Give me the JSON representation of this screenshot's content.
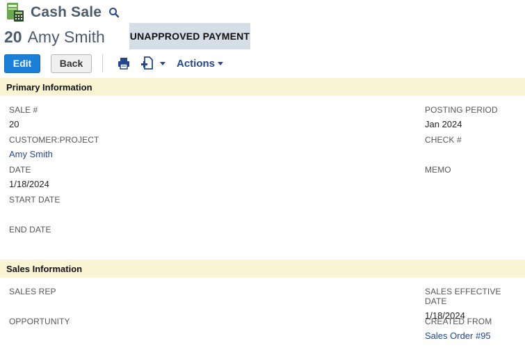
{
  "header": {
    "title": "Cash Sale",
    "record_number": "20",
    "record_name": "Amy Smith",
    "status": "UNAPPROVED PAYMENT"
  },
  "toolbar": {
    "edit_label": "Edit",
    "back_label": "Back",
    "actions_label": "Actions"
  },
  "icons": {
    "record": "cash-sale-record-icon",
    "search": "search-icon",
    "print": "print-icon",
    "new": "new-record-icon"
  },
  "primary": {
    "title": "Primary Information",
    "sale_num_label": "SALE #",
    "sale_num_value": "20",
    "customer_label": "CUSTOMER:PROJECT",
    "customer_value": "Amy Smith",
    "date_label": "DATE",
    "date_value": "1/18/2024",
    "start_date_label": "START DATE",
    "end_date_label": "END DATE",
    "posting_period_label": "POSTING PERIOD",
    "posting_period_value": "Jan 2024",
    "check_label": "CHECK #",
    "memo_label": "MEMO"
  },
  "sales": {
    "title": "Sales Information",
    "sales_rep_label": "SALES REP",
    "opportunity_label": "OPPORTUNITY",
    "effective_date_label": "SALES EFFECTIVE DATE",
    "effective_date_value": "1/18/2024",
    "created_from_label": "CREATED FROM",
    "created_from_value": "Sales Order #95"
  },
  "colors": {
    "primary_button": "#1a7fd8",
    "link": "#24478f",
    "section_bg": "#faf3d4",
    "status_bg": "#d5dde7",
    "title": "#4a5b6e"
  }
}
